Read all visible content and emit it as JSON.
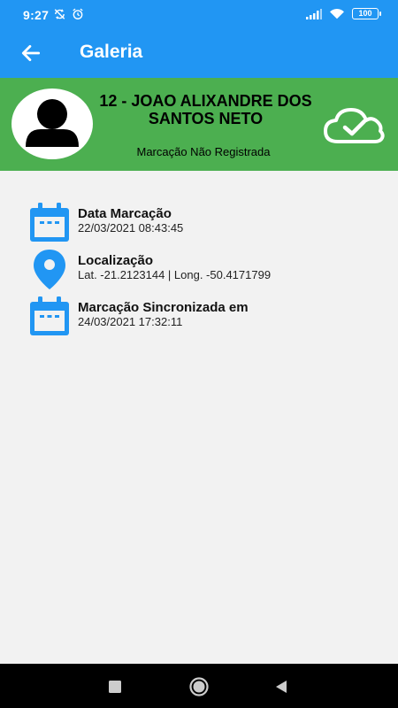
{
  "status_bar": {
    "time": "9:27",
    "battery": "100",
    "icons": [
      "sync-off-icon",
      "alarm-icon",
      "signal-icon",
      "wifi-icon",
      "battery-icon"
    ]
  },
  "app_bar": {
    "title": "Galeria",
    "back_icon": "arrow-back-icon"
  },
  "employee": {
    "name": "12 - JOAO ALIXANDRE DOS SANTOS NETO",
    "status": "Marcação Não Registrada",
    "avatar_icon": "person-icon",
    "sync_icon": "cloud-check-icon"
  },
  "details": [
    {
      "icon": "calendar-icon",
      "title": "Data Marcação",
      "value": "22/03/2021 08:43:45"
    },
    {
      "icon": "location-pin-icon",
      "title": "Localização",
      "value": "Lat. -21.2123144 | Long. -50.4171799"
    },
    {
      "icon": "calendar-icon",
      "title": "Marcação Sincronizada em",
      "value": "24/03/2021 17:32:11"
    }
  ],
  "nav_bar": {
    "buttons": [
      "recents-icon",
      "home-icon",
      "back-icon"
    ]
  },
  "colors": {
    "primary": "#2196f3",
    "banner": "#4caf50",
    "background": "#f2f2f2"
  }
}
